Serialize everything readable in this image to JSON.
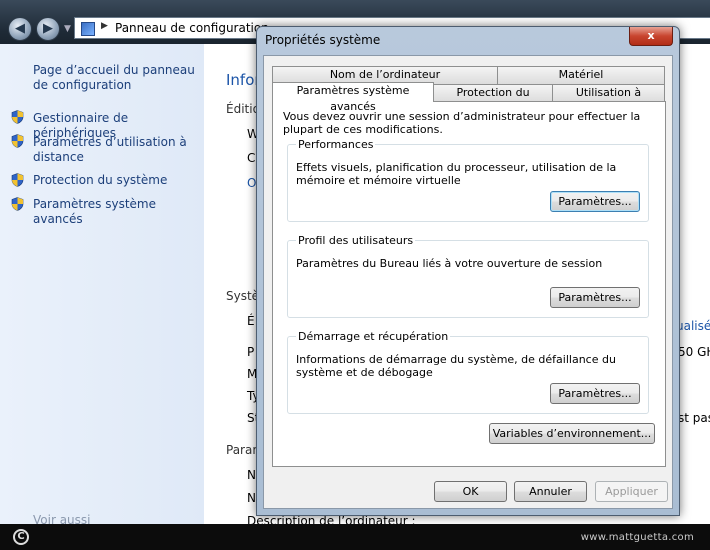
{
  "window": {
    "address_text": "Panneau de configuration"
  },
  "left_nav": {
    "home_link": "Page d’accueil du panneau de configuration",
    "items": [
      {
        "label": "Gestionnaire de périphériques",
        "icon": "shield-icon"
      },
      {
        "label": "Paramètres d’utilisation à distance",
        "icon": "shield-icon"
      },
      {
        "label": "Protection du système",
        "icon": "shield-icon"
      },
      {
        "label": "Paramètres système avancés",
        "icon": "shield-icon"
      }
    ],
    "see_also": "Voir aussi"
  },
  "background_content": {
    "title_fragment": "Infor",
    "edition_fragment": "Éditio",
    "line_w": "W",
    "line_c": "C",
    "line_o": "O",
    "system_fragment": "Systè",
    "line_e": "É",
    "line_p": "P",
    "line_m": "M",
    "line_t": "Ty",
    "line_s": "St",
    "right_actualise": "ualisé.",
    "right_ghz": "50 GH",
    "right_pas": "st pas",
    "params_fragment": "Param",
    "line_n1": "N",
    "line_n2": "N",
    "description_label": "Description de l’ordinateur :"
  },
  "dialog": {
    "title": "Propriétés système",
    "close_label": "x",
    "tabs_top": [
      "Nom de l’ordinateur",
      "Matériel"
    ],
    "tabs_bottom": [
      "Paramètres système avancés",
      "Protection du système",
      "Utilisation à distance"
    ],
    "active_tab": "Paramètres système avancés",
    "admin_note": "Vous devez ouvrir une session d’administrateur pour effectuer la plupart de ces modifications.",
    "groups": [
      {
        "label": "Performances",
        "description": "Effets visuels, planification du processeur, utilisation de la mémoire et mémoire virtuelle",
        "button": "Paramètres..."
      },
      {
        "label": "Profil des utilisateurs",
        "description": "Paramètres du Bureau liés à votre ouverture de session",
        "button": "Paramètres..."
      },
      {
        "label": "Démarrage et récupération",
        "description": "Informations de démarrage du système, de défaillance du système et de débogage",
        "button": "Paramètres..."
      }
    ],
    "env_button": "Variables d’environnement...",
    "ok_button": "OK",
    "cancel_button": "Annuler",
    "apply_button": "Appliquer"
  },
  "footer": {
    "copyright_symbol": "C",
    "watermark": "www.mattguetta.com"
  }
}
